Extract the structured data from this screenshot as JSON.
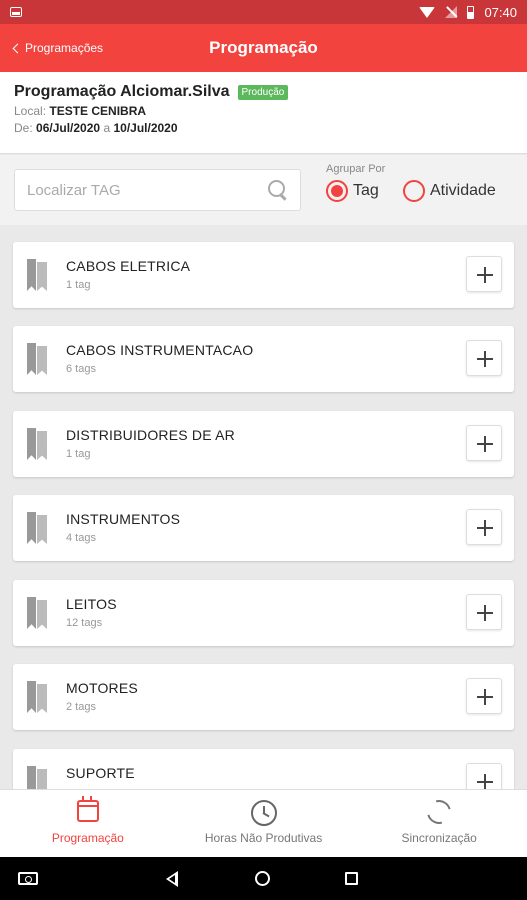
{
  "status_bar": {
    "time": "07:40",
    "icons": [
      "notification-icon",
      "wifi-icon",
      "signal-icon",
      "battery-icon"
    ]
  },
  "app_bar": {
    "back_label": "Programações",
    "title": "Programação"
  },
  "header": {
    "title": "Programação Alciomar.Silva",
    "badge": "Produção",
    "local_label": "Local:",
    "local_value": "TESTE CENIBRA",
    "date_label": "De:",
    "date_from": "06/Jul/2020",
    "date_sep": "a",
    "date_to": "10/Jul/2020"
  },
  "filter": {
    "search_placeholder": "Localizar TAG",
    "search_value": "",
    "group_by_label": "Agrupar Por",
    "options": [
      {
        "label": "Tag",
        "checked": true
      },
      {
        "label": "Atividade",
        "checked": false
      }
    ]
  },
  "groups": [
    {
      "name": "CABOS ELETRICA",
      "count": "1 tag"
    },
    {
      "name": "CABOS INSTRUMENTACAO",
      "count": "6 tags"
    },
    {
      "name": "DISTRIBUIDORES DE AR",
      "count": "1 tag"
    },
    {
      "name": "INSTRUMENTOS",
      "count": "4 tags"
    },
    {
      "name": "LEITOS",
      "count": "12 tags"
    },
    {
      "name": "MOTORES",
      "count": "2 tags"
    },
    {
      "name": "SUPORTE",
      "count": ""
    }
  ],
  "bottom_nav": {
    "items": [
      {
        "label": "Programação",
        "icon": "calendar-icon",
        "active": true
      },
      {
        "label": "Horas Não Produtivas",
        "icon": "clock-icon",
        "active": false
      },
      {
        "label": "Sincronização",
        "icon": "sync-icon",
        "active": false
      }
    ]
  },
  "colors": {
    "primary": "#f2433f",
    "status_bar": "#c8363a",
    "badge": "#5cb85c"
  }
}
